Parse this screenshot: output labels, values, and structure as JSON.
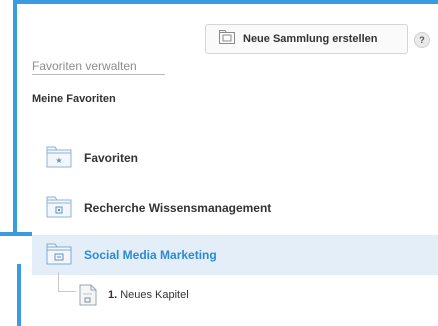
{
  "toolbar": {
    "new_collection_label": "Neue Sammlung erstellen",
    "help_label": "?"
  },
  "panel": {
    "heading": "Favoriten verwalten",
    "section_title": "Meine Favoriten"
  },
  "collections": [
    {
      "label": "Favoriten",
      "icon": "star-folder-icon",
      "selected": false
    },
    {
      "label": "Recherche Wissensmanagement",
      "icon": "folder-icon",
      "selected": false
    },
    {
      "label": "Social Media Marketing",
      "icon": "folder-icon",
      "selected": true
    }
  ],
  "chapter": {
    "number": "1.",
    "label": "Neues Kapitel",
    "icon": "document-icon"
  },
  "colors": {
    "accent": "#3a9be0",
    "selected_row_bg": "#e3eef8",
    "selected_text": "#2d8ad2"
  }
}
